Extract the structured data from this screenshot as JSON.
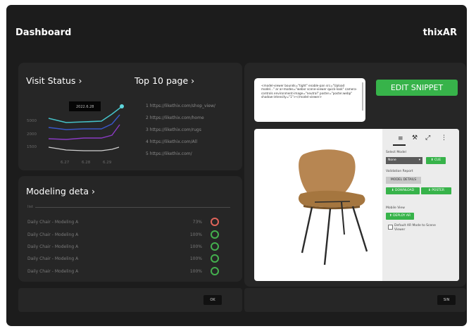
{
  "header": {
    "title": "Dashboard",
    "brand": "thixAR"
  },
  "visit_status": {
    "title": "Visit Status",
    "chevron": "›",
    "tooltip": "2022.6.28",
    "y_ticks": [
      "5000",
      "2000",
      "1500"
    ],
    "x_ticks": [
      "6.27",
      "6.28",
      "6.29"
    ]
  },
  "top_pages": {
    "title": "Top 10 page",
    "chevron": "›",
    "items": [
      "1  https://likethix.com/shop_view/",
      "2  https://likethix.com/home",
      "3  https://likethix.com/rugs",
      "4  https://likethix.com/All",
      "5  https://likethix.com/"
    ]
  },
  "modeling": {
    "title": "Modeling deta",
    "chevron": "›",
    "col_label": "list",
    "rows": [
      {
        "name": "Daily Chair - Modeling A",
        "percent": "73%",
        "progress": 0.73,
        "status": "in-progress"
      },
      {
        "name": "Daily Chair - Modeling A",
        "percent": "100%",
        "progress": 1.0,
        "status": "done"
      },
      {
        "name": "Daily Chair - Modeling A",
        "percent": "100%",
        "progress": 1.0,
        "status": "done"
      },
      {
        "name": "Daily Chair - Modeling A",
        "percent": "100%",
        "progress": 1.0,
        "status": "done"
      },
      {
        "name": "Daily Chair - Modeling A",
        "percent": "100%",
        "progress": 1.0,
        "status": "done"
      }
    ]
  },
  "footer": {
    "left_btn": "OK",
    "right_btn": "SIN"
  },
  "snippet": {
    "code": "<model-viewer bounds=\"tight\" enable-pan src=\"Upload model...\" ar ar-modes=\"webxr scene-viewer quick-look\" camera-controls environment-image=\"neutral\" poster=\"poster.webp\" shadow-intensity=\"1\"></model-viewer>",
    "edit_label": "EDIT SNIPPET"
  },
  "viewer": {
    "tools": [
      "layers-icon",
      "wrench-icon",
      "expand-icon",
      "more-icon"
    ],
    "select_model_label": "Select Model",
    "select_value": "None",
    "cue_btn": "CUE",
    "validation_label": "Validation Report",
    "model_details_btn": "MODEL DETAILS",
    "download_btn": "DOWNLOAD",
    "poster_btn": "POSTER",
    "mobile_label": "Mobile View",
    "deploy_btn": "DEPLOY AR",
    "default_checkbox_label": "Default AR Mode to Scene Viewer"
  },
  "colors": {
    "accent": "#37b34a",
    "card": "#262626",
    "frame": "#1c1c1c",
    "alert": "#e0645a"
  }
}
